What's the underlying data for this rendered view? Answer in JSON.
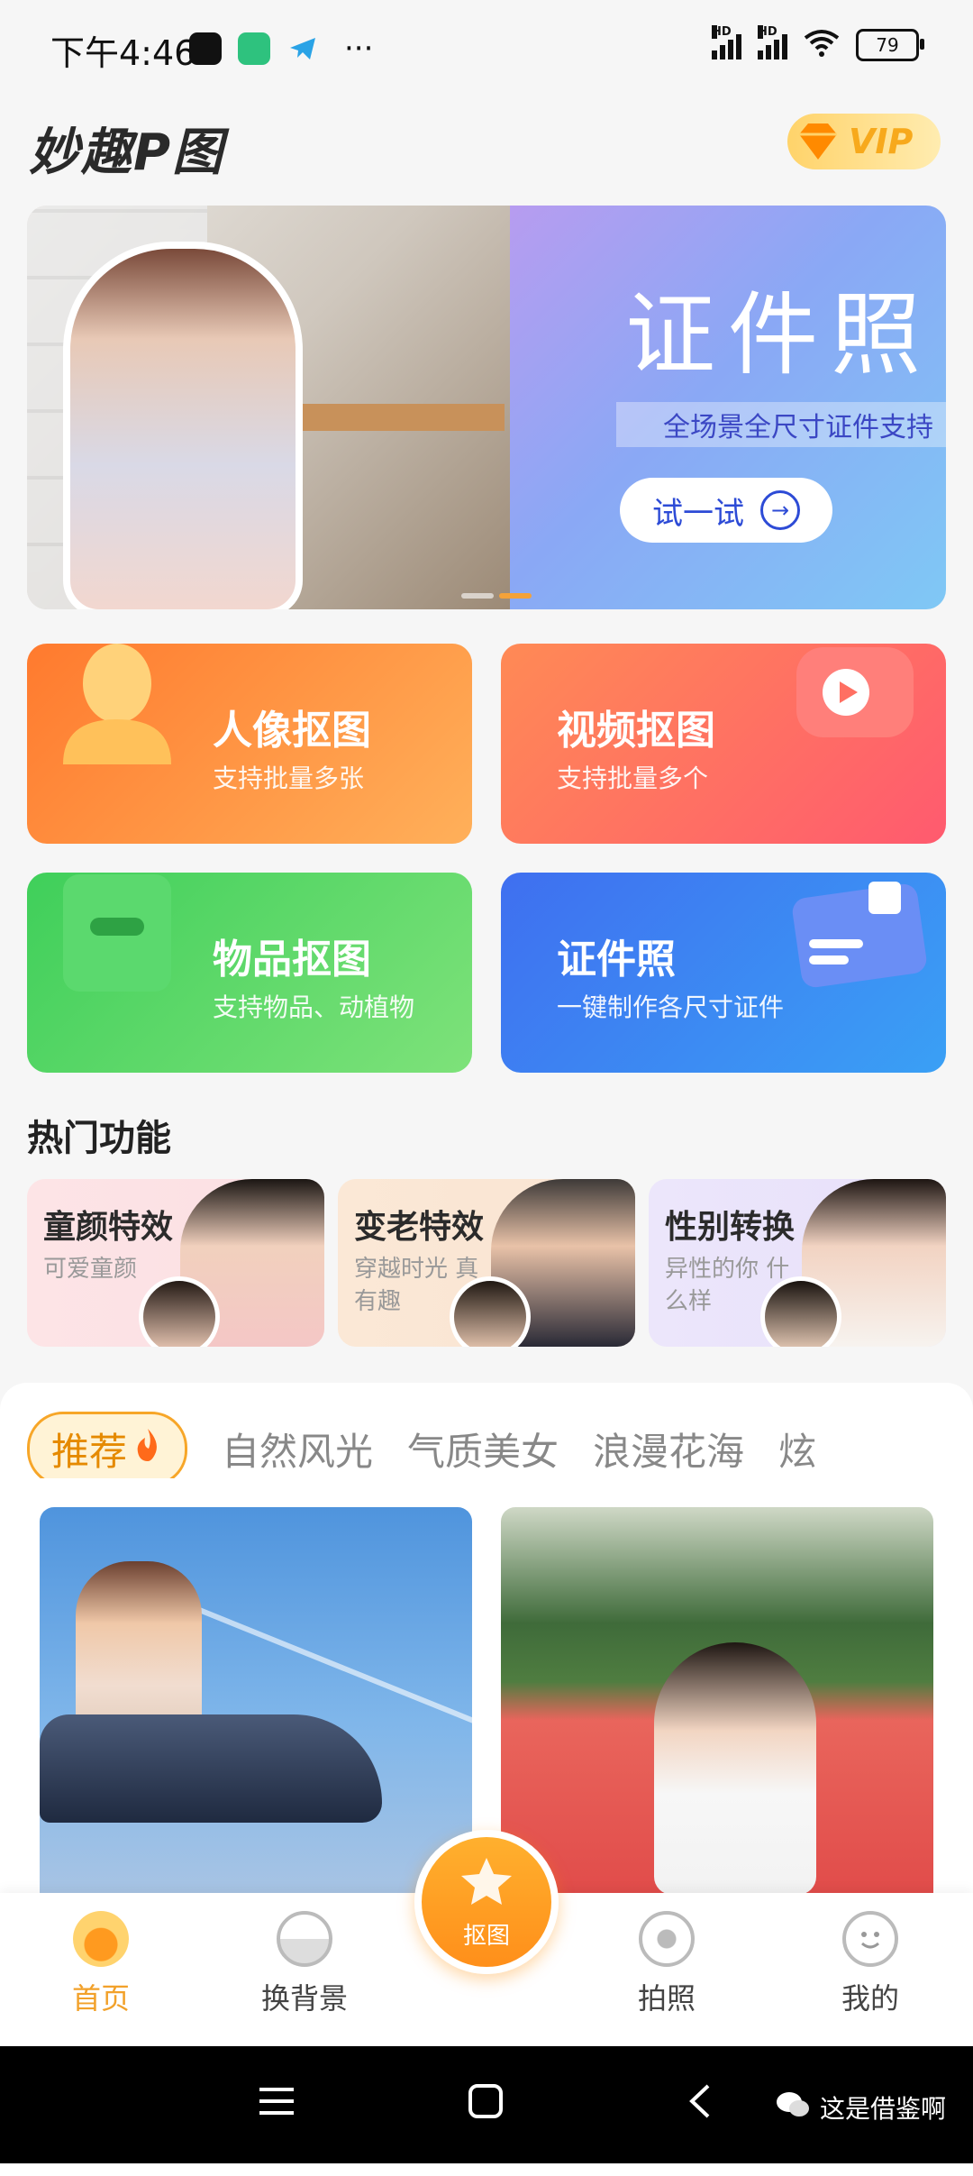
{
  "status_bar": {
    "time": "下午4:46",
    "more": "···",
    "signal_1": "HD",
    "signal_2": "HD",
    "battery": "79"
  },
  "header": {
    "logo": "妙趣P图",
    "vip_label": "VIP"
  },
  "banner": {
    "title": "证件照",
    "subtitle": "全场景全尺寸证件支持",
    "button": "试一试"
  },
  "features": [
    {
      "title": "人像抠图",
      "subtitle": "支持批量多张"
    },
    {
      "title": "视频抠图",
      "subtitle": "支持批量多个"
    },
    {
      "title": "物品抠图",
      "subtitle": "支持物品、动植物"
    },
    {
      "title": "证件照",
      "subtitle": "一键制作各尺寸证件"
    }
  ],
  "hot": {
    "title": "热门功能",
    "items": [
      {
        "title": "童颜特效",
        "subtitle": "可爱童颜"
      },
      {
        "title": "变老特效",
        "subtitle": "穿越时光 真有趣"
      },
      {
        "title": "性别转换",
        "subtitle": "异性的你 什么样"
      }
    ]
  },
  "categories": [
    "推荐",
    "自然风光",
    "气质美女",
    "浪漫花海",
    "炫"
  ],
  "nav": {
    "items": [
      "首页",
      "换背景",
      "抠图",
      "拍照",
      "我的"
    ]
  },
  "watermark": "这是借鉴啊",
  "colors": {
    "accent": "#f2a12a",
    "card_portrait": "#ff8a3a",
    "card_video": "#ff6f62",
    "card_object": "#4fd466",
    "card_id": "#3f7ff2"
  }
}
